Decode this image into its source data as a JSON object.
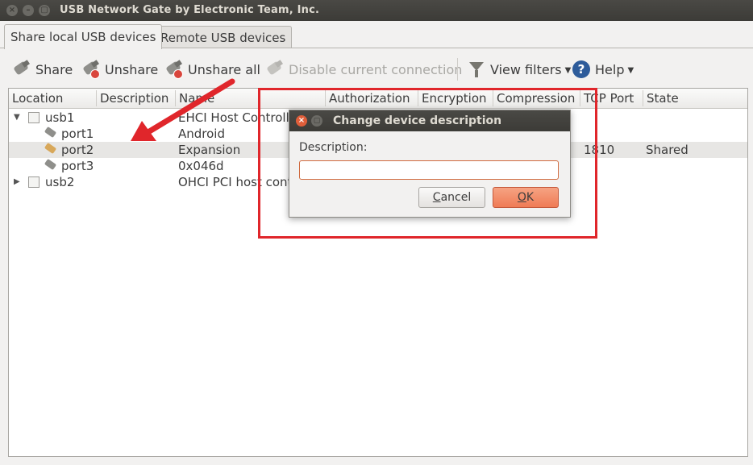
{
  "window": {
    "title": "USB Network Gate by Electronic Team, Inc."
  },
  "tabs": [
    {
      "label": "Share local USB devices",
      "active": true
    },
    {
      "label": "Remote USB devices",
      "active": false
    }
  ],
  "toolbar": {
    "share": "Share",
    "unshare": "Unshare",
    "unshare_all": "Unshare all",
    "disable_connection": "Disable current connection",
    "view_filters": "View filters",
    "help": "Help"
  },
  "table": {
    "columns": [
      "Location",
      "Description",
      "Name",
      "Authorization",
      "Encryption",
      "Compression",
      "TCP Port",
      "State"
    ],
    "rows": [
      {
        "location": "usb1",
        "name": "EHCI Host Controller",
        "tcp_port": "",
        "state": ""
      },
      {
        "location": "port1",
        "name": "Android",
        "tcp_port": "",
        "state": ""
      },
      {
        "location": "port2",
        "name": "Expansion",
        "tcp_port": "1810",
        "state": "Shared"
      },
      {
        "location": "port3",
        "name": "0x046d",
        "tcp_port": "",
        "state": ""
      },
      {
        "location": "usb2",
        "name": "OHCI PCI host controller",
        "tcp_port": "",
        "state": ""
      }
    ]
  },
  "dialog": {
    "title": "Change device description",
    "label": "Description:",
    "value": "",
    "cancel_mnemonic": "C",
    "cancel_rest": "ancel",
    "ok_mnemonic": "O",
    "ok_rest": "K"
  },
  "colors": {
    "highlight_red": "#e0262b",
    "ok_button": "#ef7b55",
    "titlebar": "#3c3b37"
  }
}
